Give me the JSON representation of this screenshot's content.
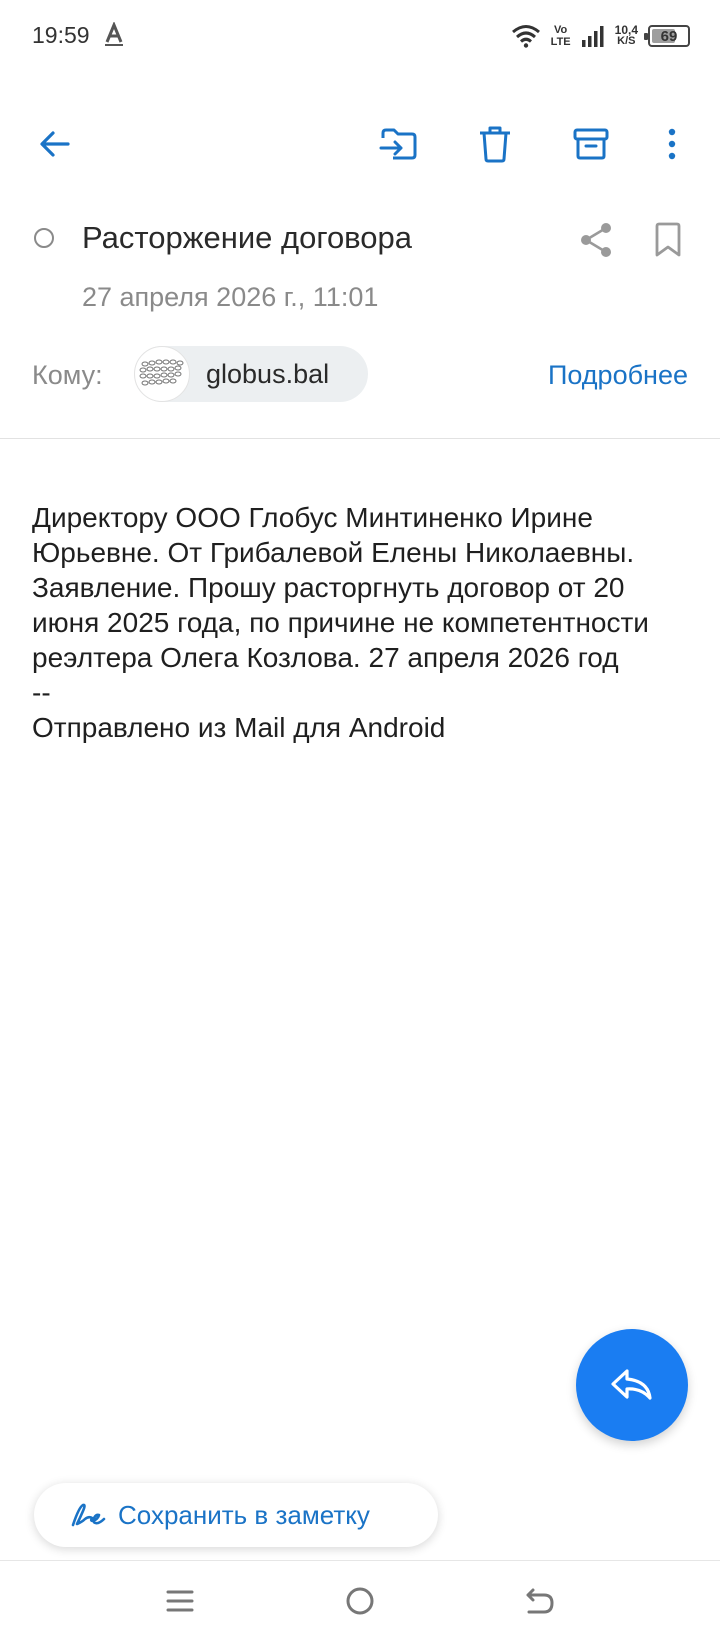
{
  "status_bar": {
    "time": "19:59",
    "volte_top": "Vo",
    "volte_bottom": "LTE",
    "net_speed_value": "10,4",
    "net_speed_unit": "K/S",
    "battery_level": "69"
  },
  "toolbar": {
    "back_icon": "arrow-left-icon",
    "move_icon": "move-to-folder-icon",
    "delete_icon": "trash-icon",
    "archive_icon": "archive-icon",
    "more_icon": "more-vertical-icon"
  },
  "email": {
    "subject": "Расторжение договора",
    "date": "27 апреля 2026 г., 11:01",
    "to_label": "Кому:",
    "recipient": "globus.bal",
    "details_link": "Подробнее",
    "body_paragraph": "Директору ООО Глобус Минтиненко Ирине Юрьевне. От Грибалевой Елены Николаевны. Заявление. Прошу расторгнуть договор от 20 июня 2025 года, по причине не компетентности реэлтера Олега Козлова. 27 апреля 2026 год",
    "signature_separator": "--",
    "signature": "Отправлено из Mail для Android"
  },
  "actions": {
    "save_note_label": "Сохранить в заметку",
    "reply_icon": "reply-icon"
  },
  "colors": {
    "accent": "#1a73c6",
    "fab": "#1a7df2",
    "muted_text": "#8a8a8a"
  }
}
